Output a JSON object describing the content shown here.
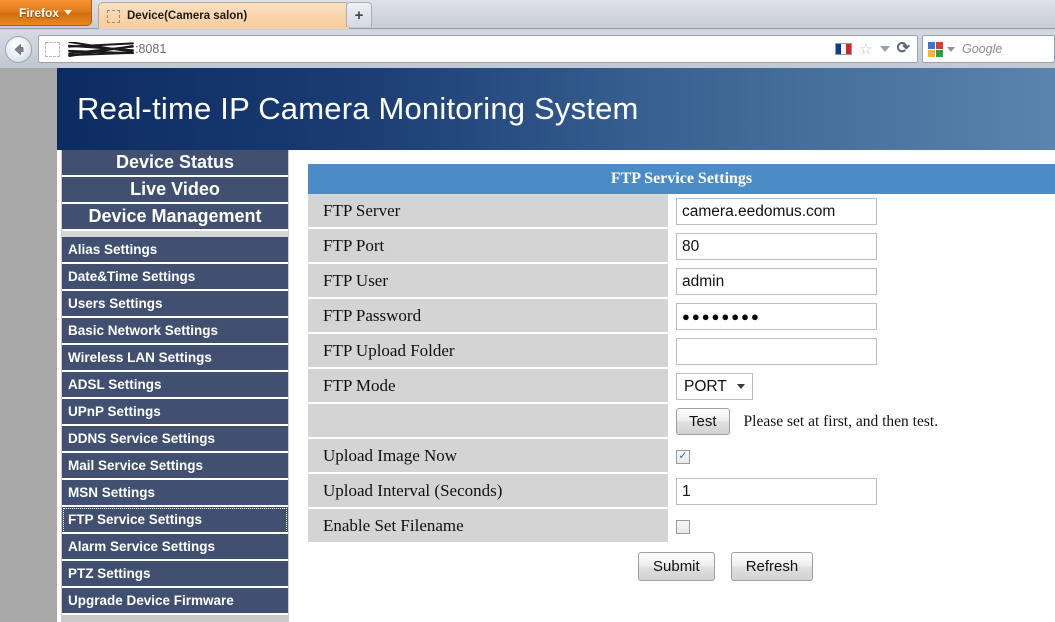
{
  "browser": {
    "app_button_label": "Firefox",
    "tab": {
      "title": "Device(Camera salon)",
      "favicon": "blank-favicon-icon"
    },
    "new_tab_label": "+",
    "back_button": "back-arrow-icon",
    "url_text": ":8081",
    "url_redacted": true,
    "toolbar_icons": [
      "flag-fr-icon",
      "star-icon",
      "chevron-down-icon",
      "reload-icon"
    ],
    "search": {
      "engine": "Google",
      "placeholder": "Google",
      "value": ""
    }
  },
  "site": {
    "header_title": "Real-time IP Camera Monitoring System"
  },
  "sidebar": {
    "top_items": [
      {
        "label": "Device Status"
      },
      {
        "label": "Live Video"
      },
      {
        "label": "Device Management"
      }
    ],
    "items": [
      {
        "label": "Alias Settings",
        "selected": false
      },
      {
        "label": "Date&Time Settings",
        "selected": false
      },
      {
        "label": "Users Settings",
        "selected": false
      },
      {
        "label": "Basic Network Settings",
        "selected": false
      },
      {
        "label": "Wireless LAN Settings",
        "selected": false
      },
      {
        "label": "ADSL Settings",
        "selected": false
      },
      {
        "label": "UPnP Settings",
        "selected": false
      },
      {
        "label": "DDNS Service Settings",
        "selected": false
      },
      {
        "label": "Mail Service Settings",
        "selected": false
      },
      {
        "label": "MSN Settings",
        "selected": false
      },
      {
        "label": "FTP Service Settings",
        "selected": true
      },
      {
        "label": "Alarm Service Settings",
        "selected": false
      },
      {
        "label": "PTZ Settings",
        "selected": false
      },
      {
        "label": "Upgrade Device Firmware",
        "selected": false
      }
    ]
  },
  "form": {
    "title": "FTP Service Settings",
    "rows": {
      "ftp_server": {
        "label": "FTP Server",
        "value": "camera.eedomus.com"
      },
      "ftp_port": {
        "label": "FTP Port",
        "value": "80"
      },
      "ftp_user": {
        "label": "FTP User",
        "value": "admin"
      },
      "ftp_password": {
        "label": "FTP Password",
        "value": "●●●●●●●●"
      },
      "ftp_upload_folder": {
        "label": "FTP Upload Folder",
        "value": ""
      },
      "ftp_mode": {
        "label": "FTP Mode",
        "value": "PORT"
      },
      "test": {
        "label": "",
        "button_label": "Test",
        "hint": "Please set at first, and then test."
      },
      "upload_now": {
        "label": "Upload Image Now",
        "checked": true,
        "mark": "✓"
      },
      "upload_interval": {
        "label": "Upload Interval (Seconds)",
        "value": "1"
      },
      "enable_filename": {
        "label": "Enable Set Filename",
        "checked": false,
        "mark": ""
      }
    },
    "actions": {
      "submit_label": "Submit",
      "refresh_label": "Refresh"
    }
  },
  "colors": {
    "header_left": "#0c2c61",
    "header_right": "#5a84ac",
    "sidebar_item": "#415070",
    "panel_title": "#4a8cc6",
    "label_cell": "#d4d4d4",
    "firefox_orange": "#e07b18"
  }
}
